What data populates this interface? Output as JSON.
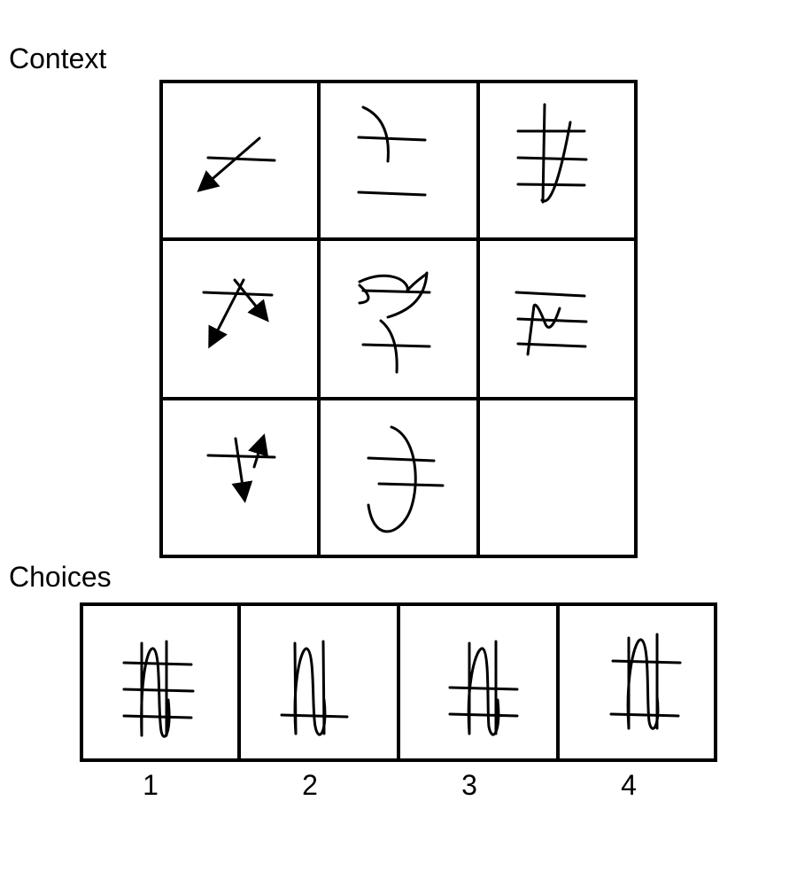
{
  "headings": {
    "context": "Context",
    "choices": "Choices"
  },
  "choice_numbers": [
    "1",
    "2",
    "3",
    "4"
  ],
  "icons": {
    "context_panels": [
      "cross-arrow-icon",
      "arc-lines-icon",
      "hash-wave-icon",
      "caret-arrows-icon",
      "curl-lines-icon",
      "wave-lines-icon",
      "arrow-pair-icon",
      "oval-lines-icon",
      "empty-slot"
    ],
    "choice_panels": [
      "wave-three-lines-icon",
      "wave-one-line-icon",
      "wave-two-lines-icon",
      "wave-two-lines-alt-icon"
    ]
  }
}
